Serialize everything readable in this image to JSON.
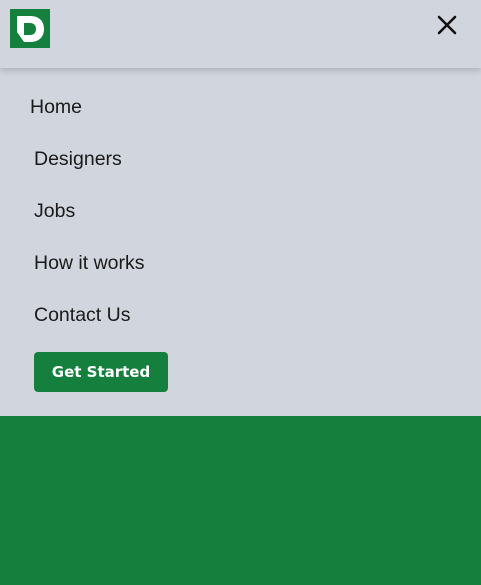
{
  "header": {
    "logo_letter": "D",
    "close_icon": "close-icon"
  },
  "nav": {
    "items": [
      {
        "label": "Home"
      },
      {
        "label": "Designers"
      },
      {
        "label": "Jobs"
      },
      {
        "label": "How it works"
      },
      {
        "label": "Contact Us"
      }
    ],
    "cta_label": "Get Started"
  },
  "colors": {
    "brand_green": "#15803d",
    "menu_background": "#d1d5de",
    "text": "#1a1a1a",
    "cta_text": "#ffffff"
  }
}
